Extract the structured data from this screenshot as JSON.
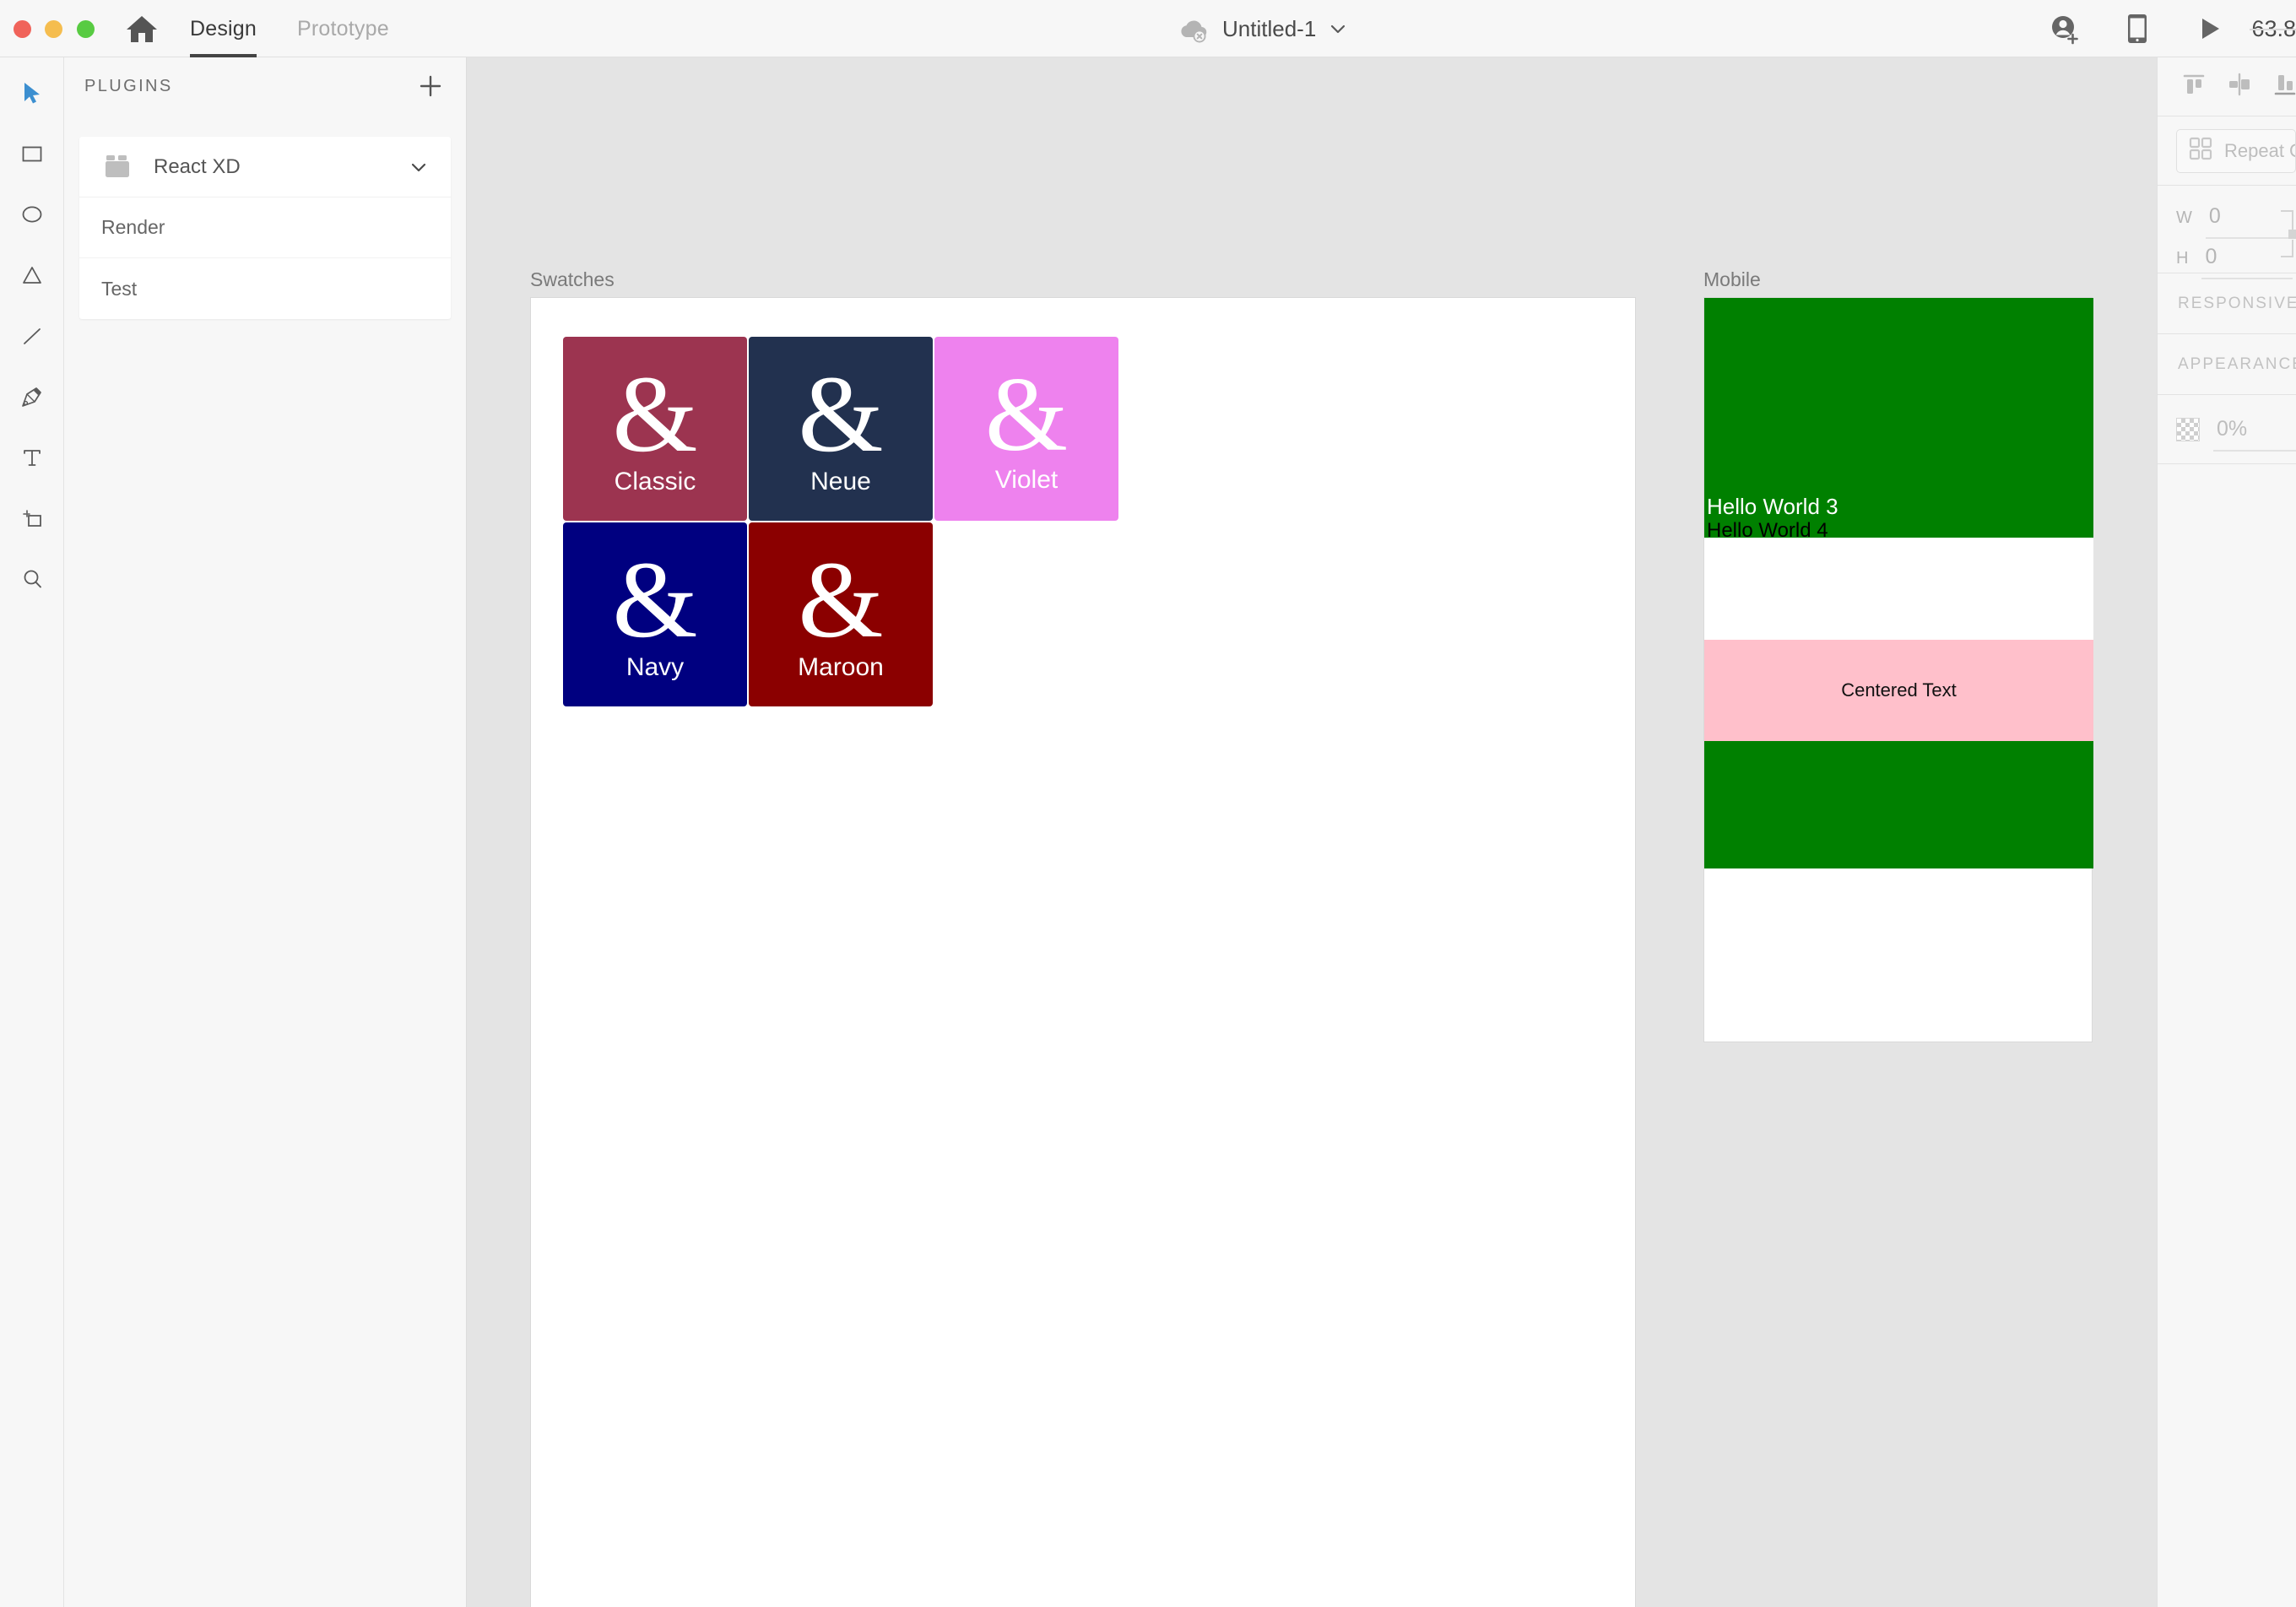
{
  "app": {
    "window_controls": [
      "close",
      "minimize",
      "maximize"
    ],
    "home_icon": "home-icon"
  },
  "topbar": {
    "tabs": [
      {
        "label": "Design",
        "active": true
      },
      {
        "label": "Prototype",
        "active": false
      }
    ],
    "document": {
      "title": "Untitled-1",
      "cloud_status_icon": "cloud-offline-icon",
      "caret_icon": "chevron-down-icon"
    },
    "actions": [
      {
        "name": "invite-icon",
        "label": "Invite to document"
      },
      {
        "name": "device-preview-icon",
        "label": "Device preview"
      },
      {
        "name": "play-icon",
        "label": "Desktop preview"
      }
    ],
    "zoom_value": "63.8"
  },
  "toolbar": {
    "tools": [
      {
        "name": "select-tool",
        "icon": "cursor-icon",
        "active": true
      },
      {
        "name": "rectangle-tool",
        "icon": "square-icon",
        "active": false
      },
      {
        "name": "ellipse-tool",
        "icon": "circle-icon",
        "active": false
      },
      {
        "name": "polygon-tool",
        "icon": "triangle-icon",
        "active": false
      },
      {
        "name": "line-tool",
        "icon": "line-icon",
        "active": false
      },
      {
        "name": "pen-tool",
        "icon": "pen-icon",
        "active": false
      },
      {
        "name": "text-tool",
        "icon": "text-t-icon",
        "active": false
      },
      {
        "name": "artboard-tool",
        "icon": "artboard-icon",
        "active": false
      },
      {
        "name": "zoom-tool",
        "icon": "magnifier-icon",
        "active": false
      }
    ]
  },
  "plugins_panel": {
    "title": "PLUGINS",
    "add_icon": "plus-icon",
    "plugin": {
      "name": "React XD",
      "icon": "puzzle-icon",
      "caret_icon": "chevron-down-icon",
      "expanded": true,
      "commands": [
        {
          "label": "Render"
        },
        {
          "label": "Test"
        }
      ]
    }
  },
  "canvas": {
    "background_color": "#E4E4E4",
    "artboards": [
      {
        "name": "Swatches",
        "label": "Swatches",
        "background_color": "#FFFFFF",
        "swatches": [
          {
            "name": "Classic",
            "glyph": "&",
            "color": "#9C3450",
            "text_color": "#FFFFFF",
            "weight": "regular"
          },
          {
            "name": "Neue",
            "glyph": "&",
            "color": "#22314F",
            "text_color": "#FFFFFF",
            "weight": "regular"
          },
          {
            "name": "Violet",
            "glyph": "&",
            "color": "#EE82EE",
            "text_color": "#FFFFFF",
            "weight": "thin"
          },
          {
            "name": "Navy",
            "glyph": "&",
            "color": "#000080",
            "text_color": "#FFFFFF",
            "weight": "regular"
          },
          {
            "name": "Maroon",
            "glyph": "&",
            "color": "#8B0000",
            "text_color": "#FFFFFF",
            "weight": "regular"
          }
        ]
      },
      {
        "name": "Mobile",
        "label": "Mobile",
        "background_color": "#FFFFFF",
        "blocks": [
          {
            "name": "green-block-1",
            "color": "#008000"
          },
          {
            "name": "white-block",
            "color": "#FFFFFF"
          },
          {
            "name": "pink-block",
            "color": "#FFC0CB",
            "text": "Centered Text",
            "text_color": "#111111"
          },
          {
            "name": "green-block-2",
            "color": "#008000"
          }
        ],
        "texts": [
          {
            "name": "hello-world-3",
            "value": "Hello World 3",
            "color": "#FFFFFF"
          },
          {
            "name": "hello-world-4",
            "value": "Hello World 4",
            "color": "#000000"
          }
        ]
      }
    ]
  },
  "right_panel": {
    "align_icons": [
      {
        "name": "align-top-icon"
      },
      {
        "name": "align-middle-icon"
      },
      {
        "name": "align-bottom-icon"
      }
    ],
    "repeat_grid": {
      "label": "Repeat G",
      "icon": "grid-icon"
    },
    "size": {
      "w_label": "W",
      "w_value": "0",
      "h_label": "H",
      "h_value": "0"
    },
    "sections": [
      {
        "label": "RESPONSIVE"
      },
      {
        "label": "APPEARANCE"
      }
    ],
    "appearance": {
      "opacity_value": "0%",
      "fill_icon": "transparent-checker-icon"
    }
  }
}
